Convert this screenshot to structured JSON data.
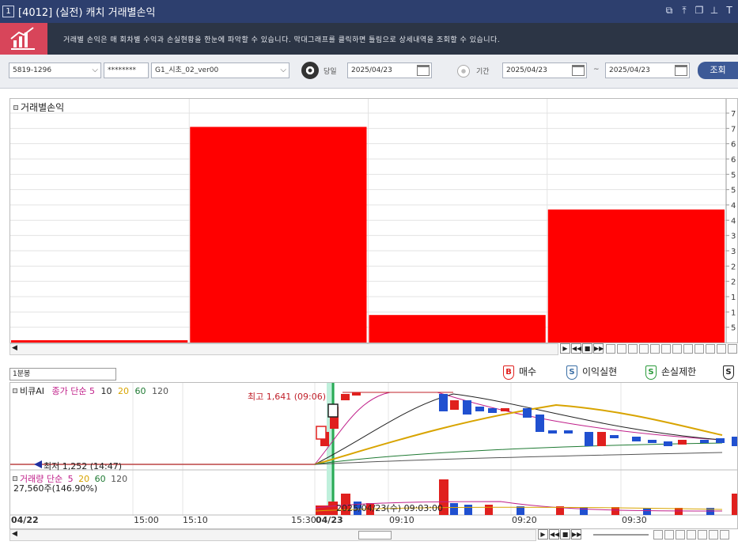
{
  "window": {
    "number": "1",
    "title": "[4012] (실전) 캐치 거래별손익",
    "icons": [
      "restore-icon",
      "pin-icon",
      "copy-icon",
      "clip-icon",
      "font-icon"
    ]
  },
  "banner": {
    "description": "거래별 손익은 매 회차별 수익과 손실현황을 한눈에 파악할 수 있습니다. 막대그래프를 클릭하면 틀림으로 상세내역을 조회할 수 있습니다."
  },
  "toolbar": {
    "account": "5819-1296",
    "password": "********",
    "strategy": "G1_시초_02_ver00",
    "today_label": "당일",
    "today_date": "2025/04/23",
    "period_label": "기간",
    "from_date": "2025/04/23",
    "range_sep": "~",
    "to_date": "2025/04/23",
    "query_label": "조회"
  },
  "upper_chart": {
    "title": "거래별손익",
    "axis_ticks": [
      "7",
      "7",
      "6",
      "6",
      "5",
      "5",
      "4",
      "4",
      "3",
      "3",
      "2",
      "2",
      "1",
      "1",
      "5"
    ]
  },
  "chart_data": {
    "type": "bar",
    "title": "거래별손익",
    "categories": [
      "",
      "",
      "",
      ""
    ],
    "values": [
      1,
      94,
      12,
      58
    ],
    "ylim": [
      0,
      100
    ],
    "color": "#ff0000"
  },
  "lower": {
    "tab_label": "1분봉",
    "legend": [
      {
        "badge": "B",
        "label": "매수",
        "color": "#e0201e"
      },
      {
        "badge": "S",
        "label": "이익실현",
        "color": "#3a6ea5"
      },
      {
        "badge": "S",
        "label": "손실제한",
        "color": "#2a9a3a"
      },
      {
        "badge": "S",
        "label": "",
        "color": "#222"
      }
    ],
    "price_panel": {
      "name": "비큐AI",
      "ma_label": "종가 단순",
      "ma_periods": [
        "5",
        "10",
        "20",
        "60",
        "120"
      ],
      "ma_colors": [
        "#c0208a",
        "#222",
        "#d8a400",
        "#1f7a33",
        "#555"
      ],
      "high_label": "최고 1,641 (09:06)",
      "low_label": "최저 1,252 (14:47)"
    },
    "volume_panel": {
      "name": "거래량 단순",
      "ma_periods": [
        "5",
        "20",
        "60",
        "120"
      ],
      "volume_text": "27,560주(146.90%)",
      "cursor_text": "2025/04/23(수) 09:03:00"
    },
    "time_labels": [
      "04/22",
      "15:00",
      "15:10",
      "15:30",
      "04/23",
      "09:10",
      "09:20",
      "09:30"
    ]
  }
}
